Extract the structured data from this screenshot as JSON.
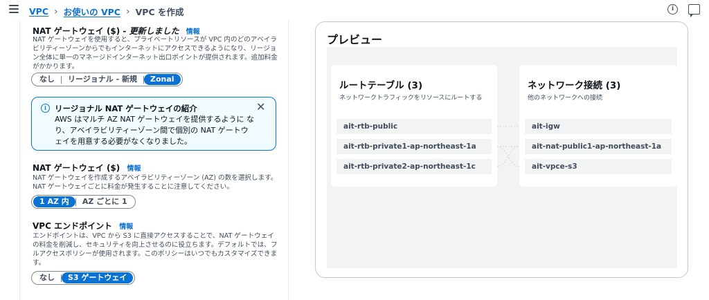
{
  "breadcrumb": {
    "items": [
      "VPC",
      "お使いの VPC"
    ],
    "current": "VPC を作成"
  },
  "nat_gateway_section": {
    "title": "NAT ゲートウェイ ($)",
    "updated": " - 更新しました",
    "info": "情報",
    "description": "NAT ゲートウェイを使用すると、プライベートリソースが VPC 内のどのアベイラビリティーゾーンからでもインターネットにアクセスできるようになり、リージョン全体に単一のマネージドインターネット出口ポイントが提供されます。追加料金がかかります。",
    "options": [
      "なし",
      "リージョナル - 新規",
      "Zonal"
    ],
    "selected": "Zonal"
  },
  "alert": {
    "title": "リージョナル NAT ゲートウェイの紹介",
    "body": "AWS はマルチ AZ NAT ゲートウェイを提供するように なり、アベイラビリティーゾーン間で個別の NAT ゲートウェイを用意する必要がなくなりました。"
  },
  "nat_az_section": {
    "title": "NAT ゲートウェイ ($)",
    "info": "情報",
    "description": "NAT ゲートウェイを作成するアベイラビリティーゾーン (AZ) の数を選択します。NAT ゲートウェイごとに料金が発生することに注意してください。",
    "options": [
      "1 AZ 内",
      "AZ ごとに 1"
    ],
    "selected": "1 AZ 内"
  },
  "endpoint_section": {
    "title": "VPC エンドポイント",
    "info": "情報",
    "description": "エンドポイントは、VPC から S3 に直接アクセスすることで、NAT ゲートウェイの料金を削減し、セキュリティを向上させるのに役立ちます。デフォルトでは、フルアクセスポリシーが使用されます。このポリシーはいつでもカスタマイズできます。",
    "options": [
      "なし",
      "S3 ゲートウェイ"
    ],
    "selected": "S3 ゲートウェイ"
  },
  "preview": {
    "title": "プレビュー",
    "route_tables": {
      "title": "ルートテーブル (3)",
      "description": "ネットワークトラフィックをリソースにルートする",
      "items": [
        "ait-rtb-public",
        "ait-rtb-private1-ap-northeast-1a",
        "ait-rtb-private2-ap-northeast-1c"
      ]
    },
    "network_connections": {
      "title": "ネットワーク接続 (3)",
      "description": "他のネットワークへの接続",
      "items": [
        "ait-igw",
        "ait-nat-public1-ap-northeast-1a",
        "ait-vpce-s3"
      ]
    }
  },
  "colors": {
    "accent": "#0972d3",
    "alert_bg": "#f0fbff",
    "text": "#0f141a",
    "muted": "#414d5c"
  },
  "icons": [
    "menu-icon",
    "chevron-right-icon",
    "info-icon",
    "feedback-icon",
    "close-icon"
  ]
}
